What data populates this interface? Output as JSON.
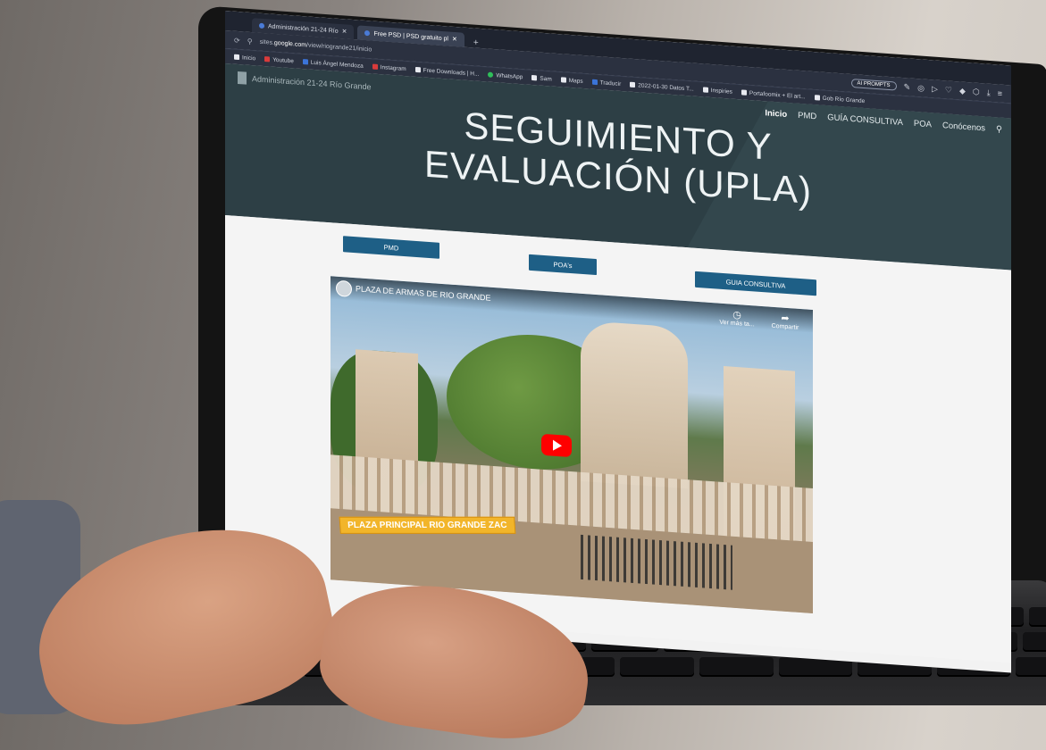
{
  "browser": {
    "tabs": [
      {
        "label": "Administración 21-24 Río",
        "active": false
      },
      {
        "label": "Free PSD | PSD gratuito pl",
        "active": true
      }
    ],
    "new_tab": "+",
    "url_prefix": "sites.",
    "url_domain": "google.com",
    "url_path": "/view/riogrande21/inicio",
    "ai_prompts": "AI PROMPTS",
    "bookmarks": [
      {
        "label": "Inicio",
        "icon": "folder-icon"
      },
      {
        "label": "Youtube",
        "icon": "youtube-icon"
      },
      {
        "label": "Luis Ángel Mendoza",
        "icon": "facebook-icon"
      },
      {
        "label": "Instagram",
        "icon": "instagram-icon"
      },
      {
        "label": "Free Downloads | H...",
        "icon": "page-icon"
      },
      {
        "label": "WhatsApp",
        "icon": "whatsapp-icon"
      },
      {
        "label": "Sam",
        "icon": "page-icon"
      },
      {
        "label": "Maps",
        "icon": "page-icon"
      },
      {
        "label": "Traducir",
        "icon": "translate-icon"
      },
      {
        "label": "2022-01-30 Datos T...",
        "icon": "page-icon"
      },
      {
        "label": "Inspiries",
        "icon": "page-icon"
      },
      {
        "label": "Portafoomix + El art...",
        "icon": "page-icon"
      },
      {
        "label": "Gob Río Grande",
        "icon": "page-icon"
      }
    ]
  },
  "site": {
    "name": "Administración 21-24 Río Grande",
    "nav": [
      "Inicio",
      "PMD",
      "GUÍA CONSULTIVA",
      "POA",
      "Conócenos"
    ],
    "title_line1": "SEGUIMIENTO Y",
    "title_line2": "EVALUACIÓN (UPLA)"
  },
  "buttons": {
    "pmd": "PMD",
    "poas": "POA's",
    "guia": "GUIA CONSULTIVA"
  },
  "video": {
    "title": "PLAZA DE ARMAS DE RIO GRANDE",
    "watch_later": "Ver más ta...",
    "share": "Compartir",
    "banner": "PLAZA PRINCIPAL RIO GRANDE ZAC"
  },
  "colors": {
    "hero": "#2d3f45",
    "button": "#1e5f86",
    "play": "#ff0000"
  }
}
